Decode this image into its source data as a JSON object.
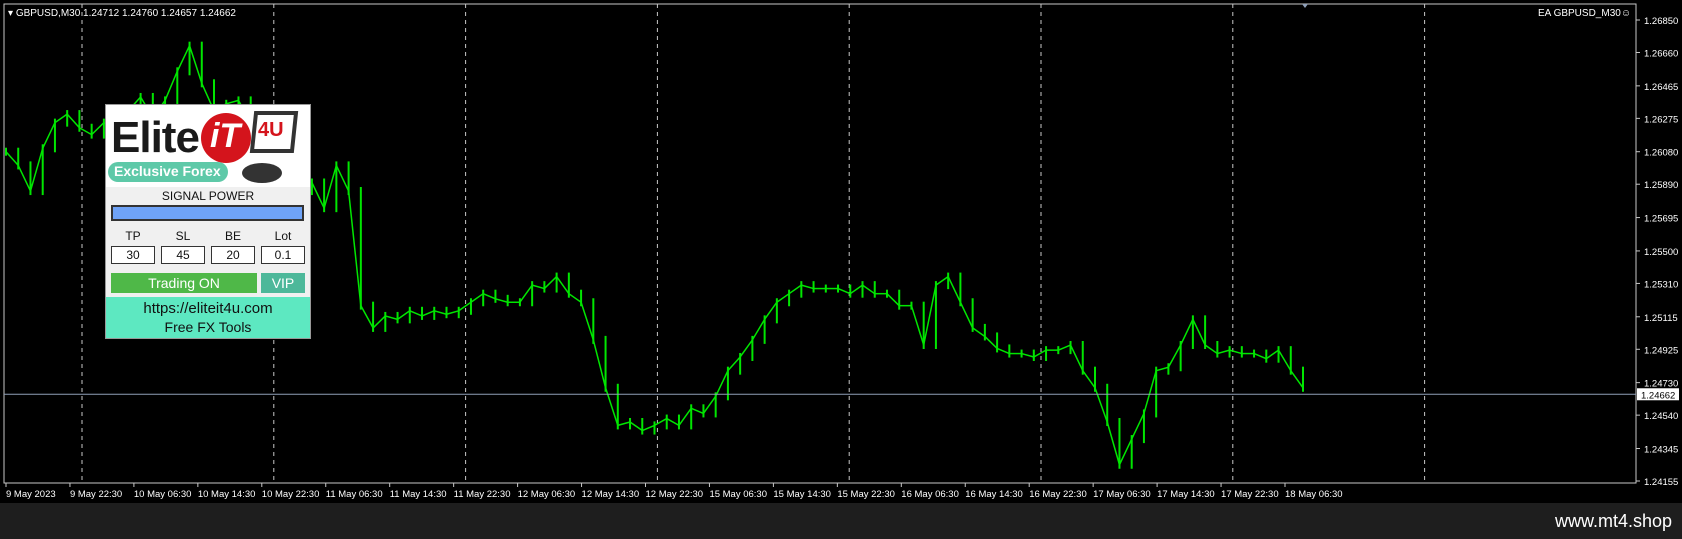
{
  "header": {
    "symbol_info": "GBPUSD,M30  1.24712 1.24760 1.24657 1.24662",
    "ea_label": "EA GBPUSD_M30☺"
  },
  "price_axis": {
    "labels": [
      "1.26850",
      "1.26660",
      "1.26465",
      "1.26275",
      "1.26080",
      "1.25890",
      "1.25695",
      "1.25500",
      "1.25310",
      "1.25115",
      "1.24925",
      "1.24730",
      "1.24540",
      "1.24345",
      "1.24155"
    ],
    "current_price": "1.24662"
  },
  "time_axis": {
    "labels": [
      "9 May 2023",
      "9 May 22:30",
      "10 May 06:30",
      "10 May 14:30",
      "10 May 22:30",
      "11 May 06:30",
      "11 May 14:30",
      "11 May 22:30",
      "12 May 06:30",
      "12 May 14:30",
      "12 May 22:30",
      "15 May 06:30",
      "15 May 14:30",
      "15 May 22:30",
      "16 May 06:30",
      "16 May 14:30",
      "16 May 22:30",
      "17 May 06:30",
      "17 May 14:30",
      "17 May 22:30",
      "18 May 06:30"
    ]
  },
  "colors": {
    "candle": "#00e600",
    "grid": "#c8c8c8",
    "background": "#000000",
    "price_line": "#8fa0b8"
  },
  "panel": {
    "logo_word": "Elite",
    "logo_it": "iT",
    "logo_4u": "4U",
    "logo_tagline": "Exclusive Forex",
    "signal_title": "SIGNAL POWER",
    "fields": [
      {
        "label": "TP",
        "value": "30"
      },
      {
        "label": "SL",
        "value": "45"
      },
      {
        "label": "BE",
        "value": "20"
      },
      {
        "label": "Lot",
        "value": "0.1"
      }
    ],
    "trading_button": "Trading ON",
    "vip_button": "VIP",
    "url": "https://eliteit4u.com",
    "free_tools": "Free FX Tools"
  },
  "footer": {
    "site": "www.mt4.shop"
  },
  "chart_data": {
    "type": "line",
    "title": "GBPUSD,M30",
    "ylim": [
      1.24155,
      1.2685
    ],
    "y_ticks": [
      1.2685,
      1.2666,
      1.26465,
      1.26275,
      1.2608,
      1.2589,
      1.25695,
      1.255,
      1.2531,
      1.25115,
      1.24925,
      1.2473,
      1.2454,
      1.24345,
      1.24155
    ],
    "x_ticks": [
      "9 May 2023",
      "9 May 22:30",
      "10 May 06:30",
      "10 May 14:30",
      "10 May 22:30",
      "11 May 06:30",
      "11 May 14:30",
      "11 May 22:30",
      "12 May 06:30",
      "12 May 14:30",
      "12 May 22:30",
      "15 May 06:30",
      "15 May 14:30",
      "15 May 22:30",
      "16 May 06:30",
      "16 May 14:30",
      "16 May 22:30",
      "17 May 06:30",
      "17 May 14:30",
      "17 May 22:30",
      "18 May 06:30"
    ],
    "series": [
      {
        "name": "GBPUSD",
        "values": [
          1.2608,
          1.26,
          1.2585,
          1.261,
          1.2625,
          1.263,
          1.2622,
          1.2618,
          1.2625,
          1.262,
          1.2632,
          1.264,
          1.2628,
          1.2638,
          1.2655,
          1.267,
          1.2648,
          1.2632,
          1.2636,
          1.2638,
          1.2625,
          1.2618,
          1.2605,
          1.257,
          1.2585,
          1.259,
          1.2575,
          1.26,
          1.2585,
          1.2518,
          1.2505,
          1.2512,
          1.251,
          1.2515,
          1.2512,
          1.2515,
          1.2513,
          1.2515,
          1.252,
          1.2525,
          1.2522,
          1.252,
          1.252,
          1.253,
          1.2528,
          1.2535,
          1.2525,
          1.252,
          1.2498,
          1.247,
          1.2448,
          1.245,
          1.2445,
          1.2448,
          1.2452,
          1.2448,
          1.2458,
          1.2455,
          1.2465,
          1.248,
          1.2488,
          1.2498,
          1.251,
          1.252,
          1.2525,
          1.253,
          1.2528,
          1.2528,
          1.2528,
          1.2525,
          1.253,
          1.2525,
          1.2525,
          1.2518,
          1.2518,
          1.2495,
          1.253,
          1.2535,
          1.252,
          1.2505,
          1.25,
          1.2493,
          1.249,
          1.249,
          1.2488,
          1.2492,
          1.2492,
          1.2495,
          1.248,
          1.247,
          1.245,
          1.2425,
          1.244,
          1.2455,
          1.248,
          1.2482,
          1.2495,
          1.251,
          1.2495,
          1.249,
          1.2492,
          1.249,
          1.249,
          1.2487,
          1.2492,
          1.248,
          1.247
        ]
      }
    ]
  }
}
